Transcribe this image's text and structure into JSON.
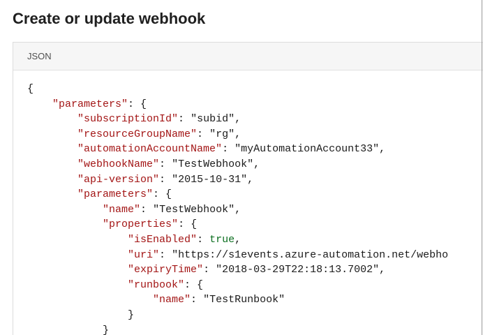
{
  "page": {
    "title": "Create or update webhook"
  },
  "code_panel": {
    "header_label": "JSON",
    "lines": [
      [
        {
          "t": "p",
          "v": "{"
        }
      ],
      [
        {
          "t": "p",
          "v": "    "
        },
        {
          "t": "k",
          "v": "\"parameters\""
        },
        {
          "t": "p",
          "v": ": {"
        }
      ],
      [
        {
          "t": "p",
          "v": "        "
        },
        {
          "t": "k",
          "v": "\"subscriptionId\""
        },
        {
          "t": "p",
          "v": ": "
        },
        {
          "t": "s",
          "v": "\"subid\""
        },
        {
          "t": "p",
          "v": ","
        }
      ],
      [
        {
          "t": "p",
          "v": "        "
        },
        {
          "t": "k",
          "v": "\"resourceGroupName\""
        },
        {
          "t": "p",
          "v": ": "
        },
        {
          "t": "s",
          "v": "\"rg\""
        },
        {
          "t": "p",
          "v": ","
        }
      ],
      [
        {
          "t": "p",
          "v": "        "
        },
        {
          "t": "k",
          "v": "\"automationAccountName\""
        },
        {
          "t": "p",
          "v": ": "
        },
        {
          "t": "s",
          "v": "\"myAutomationAccount33\""
        },
        {
          "t": "p",
          "v": ","
        }
      ],
      [
        {
          "t": "p",
          "v": "        "
        },
        {
          "t": "k",
          "v": "\"webhookName\""
        },
        {
          "t": "p",
          "v": ": "
        },
        {
          "t": "s",
          "v": "\"TestWebhook\""
        },
        {
          "t": "p",
          "v": ","
        }
      ],
      [
        {
          "t": "p",
          "v": "        "
        },
        {
          "t": "k",
          "v": "\"api-version\""
        },
        {
          "t": "p",
          "v": ": "
        },
        {
          "t": "s",
          "v": "\"2015-10-31\""
        },
        {
          "t": "p",
          "v": ","
        }
      ],
      [
        {
          "t": "p",
          "v": "        "
        },
        {
          "t": "k",
          "v": "\"parameters\""
        },
        {
          "t": "p",
          "v": ": {"
        }
      ],
      [
        {
          "t": "p",
          "v": "            "
        },
        {
          "t": "k",
          "v": "\"name\""
        },
        {
          "t": "p",
          "v": ": "
        },
        {
          "t": "s",
          "v": "\"TestWebhook\""
        },
        {
          "t": "p",
          "v": ","
        }
      ],
      [
        {
          "t": "p",
          "v": "            "
        },
        {
          "t": "k",
          "v": "\"properties\""
        },
        {
          "t": "p",
          "v": ": {"
        }
      ],
      [
        {
          "t": "p",
          "v": "                "
        },
        {
          "t": "k",
          "v": "\"isEnabled\""
        },
        {
          "t": "p",
          "v": ": "
        },
        {
          "t": "b",
          "v": "true"
        },
        {
          "t": "p",
          "v": ","
        }
      ],
      [
        {
          "t": "p",
          "v": "                "
        },
        {
          "t": "k",
          "v": "\"uri\""
        },
        {
          "t": "p",
          "v": ": "
        },
        {
          "t": "s",
          "v": "\"https://s1events.azure-automation.net/webho"
        }
      ],
      [
        {
          "t": "p",
          "v": "                "
        },
        {
          "t": "k",
          "v": "\"expiryTime\""
        },
        {
          "t": "p",
          "v": ": "
        },
        {
          "t": "s",
          "v": "\"2018-03-29T22:18:13.7002\""
        },
        {
          "t": "p",
          "v": ","
        }
      ],
      [
        {
          "t": "p",
          "v": "                "
        },
        {
          "t": "k",
          "v": "\"runbook\""
        },
        {
          "t": "p",
          "v": ": {"
        }
      ],
      [
        {
          "t": "p",
          "v": "                    "
        },
        {
          "t": "k",
          "v": "\"name\""
        },
        {
          "t": "p",
          "v": ": "
        },
        {
          "t": "s",
          "v": "\"TestRunbook\""
        }
      ],
      [
        {
          "t": "p",
          "v": "                }"
        }
      ],
      [
        {
          "t": "p",
          "v": "            }"
        }
      ]
    ]
  },
  "colors": {
    "key": "#a31515",
    "string": "#1a1a1a",
    "boolean": "#0b6e1f",
    "punctuation": "#1a1a1a"
  }
}
